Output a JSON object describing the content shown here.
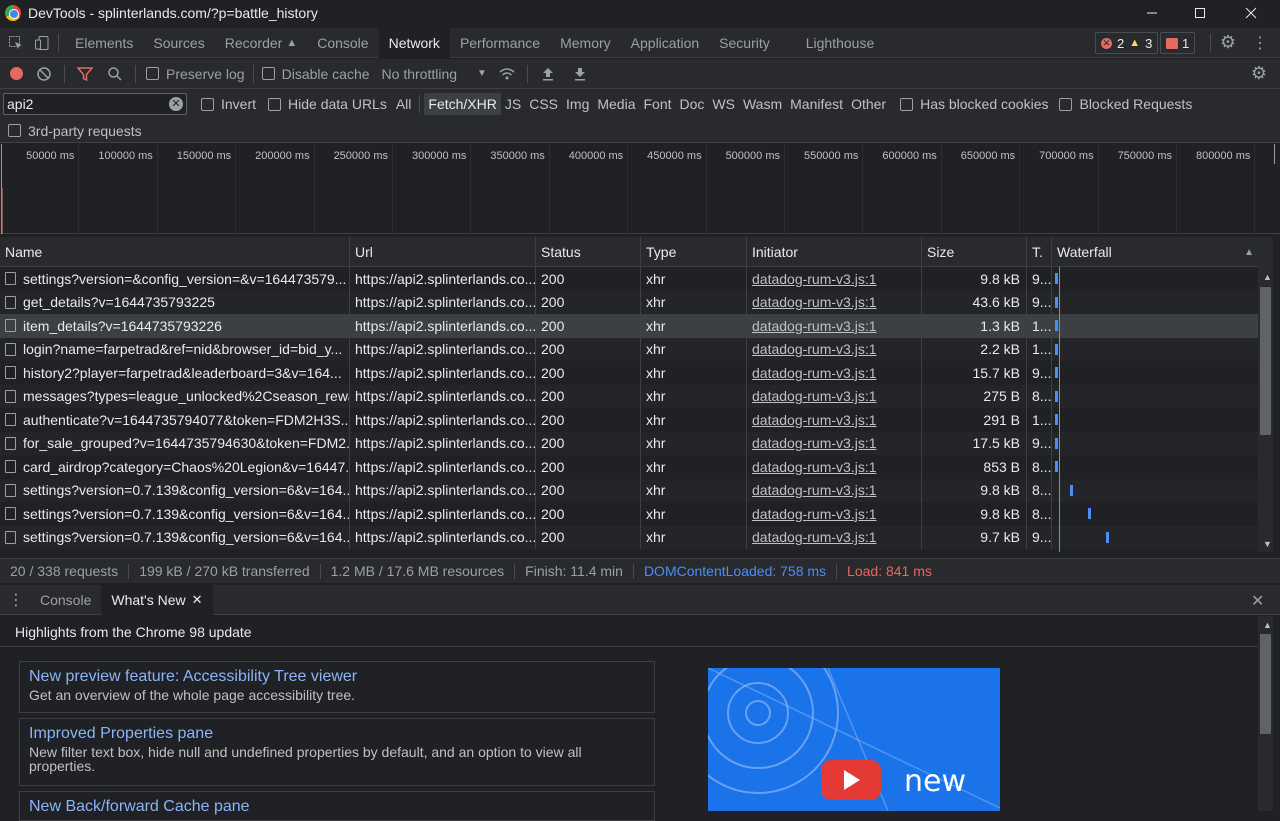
{
  "window": {
    "title": "DevTools - splinterlands.com/?p=battle_history"
  },
  "tabs": [
    "Elements",
    "Sources",
    "Recorder",
    "Console",
    "Network",
    "Performance",
    "Memory",
    "Application",
    "Security",
    "Lighthouse"
  ],
  "issues": {
    "errors": "2",
    "warnings": "3",
    "messages": "1"
  },
  "controls": {
    "preserve_log": "Preserve log",
    "disable_cache": "Disable cache",
    "throttling": "No throttling"
  },
  "filter": {
    "value": "api2",
    "invert": "Invert",
    "hide_data_urls": "Hide data URLs",
    "types": [
      "All",
      "Fetch/XHR",
      "JS",
      "CSS",
      "Img",
      "Media",
      "Font",
      "Doc",
      "WS",
      "Wasm",
      "Manifest",
      "Other"
    ],
    "has_blocked_cookies": "Has blocked cookies",
    "blocked_requests": "Blocked Requests",
    "third_party": "3rd-party requests"
  },
  "timeline_ticks": [
    "50000 ms",
    "100000 ms",
    "150000 ms",
    "200000 ms",
    "250000 ms",
    "300000 ms",
    "350000 ms",
    "400000 ms",
    "450000 ms",
    "500000 ms",
    "550000 ms",
    "600000 ms",
    "650000 ms",
    "700000 ms",
    "750000 ms",
    "800000 ms"
  ],
  "columns": {
    "name": "Name",
    "url": "Url",
    "status": "Status",
    "type": "Type",
    "initiator": "Initiator",
    "size": "Size",
    "time": "T.",
    "waterfall": "Waterfall"
  },
  "requests": [
    {
      "name": "settings?version=&config_version=&v=164473579...",
      "url": "https://api2.splinterlands.co...",
      "status": "200",
      "type": "xhr",
      "initiator": "datadog-rum-v3.js:1",
      "size": "9.8 kB",
      "time": "9..."
    },
    {
      "name": "get_details?v=1644735793225",
      "url": "https://api2.splinterlands.co...",
      "status": "200",
      "type": "xhr",
      "initiator": "datadog-rum-v3.js:1",
      "size": "43.6 kB",
      "time": "9..."
    },
    {
      "name": "item_details?v=1644735793226",
      "url": "https://api2.splinterlands.co...",
      "status": "200",
      "type": "xhr",
      "initiator": "datadog-rum-v3.js:1",
      "size": "1.3 kB",
      "time": "1..."
    },
    {
      "name": "login?name=farpetrad&ref=nid&browser_id=bid_y...",
      "url": "https://api2.splinterlands.co...",
      "status": "200",
      "type": "xhr",
      "initiator": "datadog-rum-v3.js:1",
      "size": "2.2 kB",
      "time": "1..."
    },
    {
      "name": "history2?player=farpetrad&leaderboard=3&v=164...",
      "url": "https://api2.splinterlands.co...",
      "status": "200",
      "type": "xhr",
      "initiator": "datadog-rum-v3.js:1",
      "size": "15.7 kB",
      "time": "9..."
    },
    {
      "name": "messages?types=league_unlocked%2Cseason_rewa...",
      "url": "https://api2.splinterlands.co...",
      "status": "200",
      "type": "xhr",
      "initiator": "datadog-rum-v3.js:1",
      "size": "275 B",
      "time": "8..."
    },
    {
      "name": "authenticate?v=1644735794077&token=FDM2H3S...",
      "url": "https://api2.splinterlands.co...",
      "status": "200",
      "type": "xhr",
      "initiator": "datadog-rum-v3.js:1",
      "size": "291 B",
      "time": "1..."
    },
    {
      "name": "for_sale_grouped?v=1644735794630&token=FDM2...",
      "url": "https://api2.splinterlands.co...",
      "status": "200",
      "type": "xhr",
      "initiator": "datadog-rum-v3.js:1",
      "size": "17.5 kB",
      "time": "9..."
    },
    {
      "name": "card_airdrop?category=Chaos%20Legion&v=16447...",
      "url": "https://api2.splinterlands.co...",
      "status": "200",
      "type": "xhr",
      "initiator": "datadog-rum-v3.js:1",
      "size": "853 B",
      "time": "8..."
    },
    {
      "name": "settings?version=0.7.139&config_version=6&v=164...",
      "url": "https://api2.splinterlands.co...",
      "status": "200",
      "type": "xhr",
      "initiator": "datadog-rum-v3.js:1",
      "size": "9.8 kB",
      "time": "8..."
    },
    {
      "name": "settings?version=0.7.139&config_version=6&v=164...",
      "url": "https://api2.splinterlands.co...",
      "status": "200",
      "type": "xhr",
      "initiator": "datadog-rum-v3.js:1",
      "size": "9.8 kB",
      "time": "8..."
    },
    {
      "name": "settings?version=0.7.139&config_version=6&v=164...",
      "url": "https://api2.splinterlands.co...",
      "status": "200",
      "type": "xhr",
      "initiator": "datadog-rum-v3.js:1",
      "size": "9.7 kB",
      "time": "9..."
    }
  ],
  "summary": {
    "requests": "20 / 338 requests",
    "transferred": "199 kB / 270 kB transferred",
    "resources": "1.2 MB / 17.6 MB resources",
    "finish": "Finish: 11.4 min",
    "dcl": "DOMContentLoaded: 758 ms",
    "load": "Load: 841 ms"
  },
  "drawer": {
    "tabs": [
      "Console",
      "What's New"
    ],
    "heading": "Highlights from the Chrome 98 update",
    "items": [
      {
        "title": "New preview feature: Accessibility Tree viewer",
        "desc": "Get an overview of the whole page accessibility tree."
      },
      {
        "title": "Improved Properties pane",
        "desc": "New filter text box, hide null and undefined properties by default, and an option to view all properties."
      },
      {
        "title": "New Back/forward Cache pane",
        "desc": ""
      }
    ],
    "promo_text": "new"
  },
  "colors": {
    "accent": "#8ab4f8",
    "record": "#e46962",
    "dcl": "#4a8ef7",
    "load": "#e46962",
    "waterfall": "#4a8ef7"
  }
}
